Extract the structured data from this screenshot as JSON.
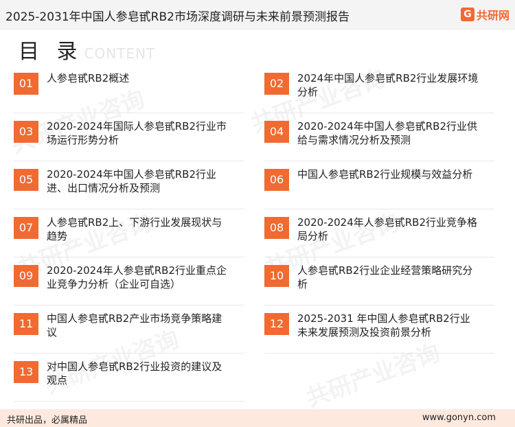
{
  "header": {
    "title": "2025-2031年中国人参皂甙RB2市场深度调研与未来前景预测报告",
    "logo_mark": "G",
    "logo_text": "共研网"
  },
  "toc": {
    "title": "目 录",
    "subtitle": "CONTENT",
    "items": [
      {
        "num": "01",
        "label": "人参皂甙RB2概述"
      },
      {
        "num": "02",
        "label": "2024年中国人参皂甙RB2行业发展环境分析"
      },
      {
        "num": "03",
        "label": "2020-2024年国际人参皂甙RB2行业市场运行形势分析"
      },
      {
        "num": "04",
        "label": "2020-2024年中国人参皂甙RB2行业供给与需求情况分析及预测"
      },
      {
        "num": "05",
        "label": "2020-2024年中国人参皂甙RB2行业进、出口情况分析及预测"
      },
      {
        "num": "06",
        "label": "中国人参皂甙RB2行业规模与效益分析"
      },
      {
        "num": "07",
        "label": "人参皂甙RB2上、下游行业发展现状与趋势"
      },
      {
        "num": "08",
        "label": "2020-2024年人参皂甙RB2行业竞争格局分析"
      },
      {
        "num": "09",
        "label": "2020-2024年人参皂甙RB2行业重点企业竞争力分析（企业可自选）"
      },
      {
        "num": "10",
        "label": "人参皂甙RB2行业企业经营策略研究分析"
      },
      {
        "num": "11",
        "label": "中国人参皂甙RB2产业市场竞争策略建议"
      },
      {
        "num": "12",
        "label": "2025-2031 年中国人参皂甙RB2行业未来发展预测及投资前景分析"
      },
      {
        "num": "13",
        "label": "对中国人参皂甙RB2行业投资的建议及观点"
      }
    ]
  },
  "footer": {
    "left": "共研出品，必属精品",
    "right": "www.gonyn.com"
  },
  "watermark": "共研产业咨询",
  "colors": {
    "accent": "#f06a32",
    "footer_bg": "#fde9de",
    "header_bg": "#f4f4f4"
  }
}
